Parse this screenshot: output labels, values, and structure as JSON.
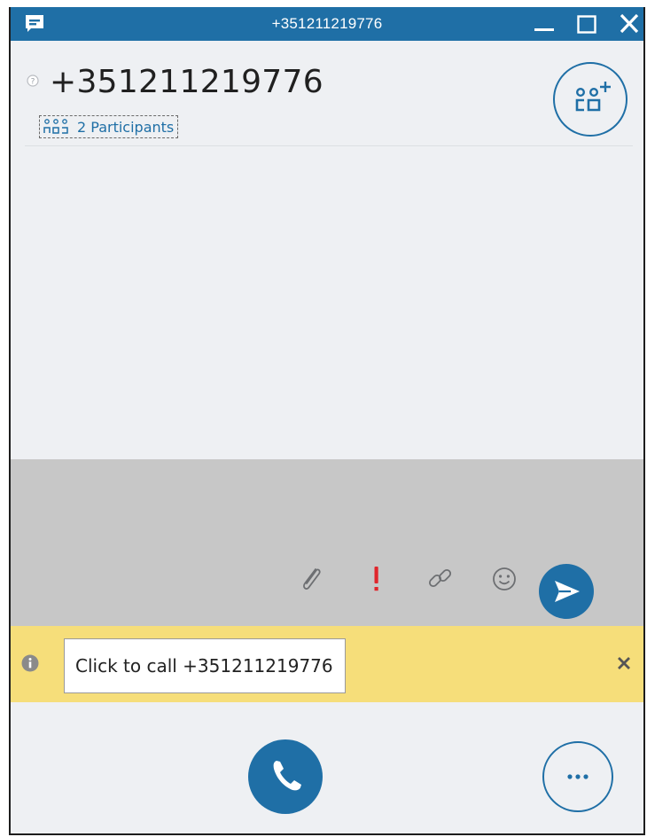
{
  "window": {
    "title": "+351211219776",
    "icons": {
      "app": "chat-bubble-icon",
      "minimize": "minimize-icon",
      "maximize": "maximize-icon",
      "close": "close-icon"
    }
  },
  "header": {
    "contact_name": "+351211219776",
    "participants_label": "2 Participants",
    "icons": {
      "presence": "unknown-presence-icon",
      "participants": "participants-icon",
      "add_people": "add-people-icon"
    }
  },
  "compose": {
    "tools": [
      "attach-file-icon",
      "high-importance-icon",
      "link-icon",
      "emoticon-icon"
    ],
    "send_icon": "send-icon"
  },
  "info_bar": {
    "message": "Click to call +351211219776",
    "icons": {
      "info": "info-icon",
      "dismiss": "dismiss-icon"
    }
  },
  "bottom_bar": {
    "icons": {
      "call": "phone-icon",
      "more": "more-options-icon"
    }
  },
  "colors": {
    "accent": "#1f6fa6",
    "window_bg": "#eef0f3",
    "compose_bg": "#c7c7c7",
    "info_bar_bg": "#f6de7a",
    "importance_red": "#e0262c"
  }
}
